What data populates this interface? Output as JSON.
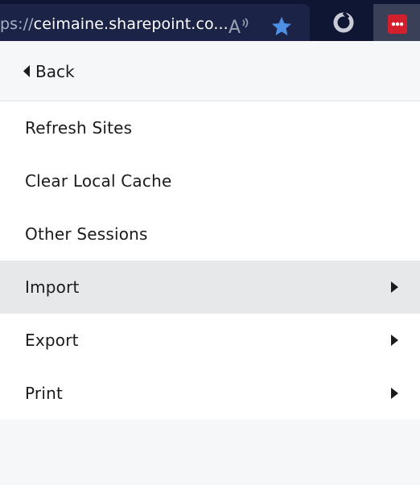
{
  "browser": {
    "url_scheme_fragment": "ps://",
    "url_host": "ceimaine.sharepoint.co...",
    "icons": {
      "read_aloud": "read-aloud-icon",
      "favorite": "star-icon",
      "extension_1": "ring-extension-icon",
      "extension_2": "lastpass-icon"
    },
    "colors": {
      "toolbar_bg": "#0f1633",
      "urlbar_bg": "#1b2446",
      "star": "#4d90e6",
      "lastpass_red": "#d21f2b"
    }
  },
  "panel": {
    "back_label": "Back",
    "items": [
      {
        "label": "Refresh Sites",
        "has_submenu": false
      },
      {
        "label": "Clear Local Cache",
        "has_submenu": false
      },
      {
        "label": "Other Sessions",
        "has_submenu": false
      },
      {
        "label": "Import",
        "has_submenu": true,
        "highlighted": true
      },
      {
        "label": "Export",
        "has_submenu": true
      },
      {
        "label": "Print",
        "has_submenu": true
      }
    ]
  }
}
